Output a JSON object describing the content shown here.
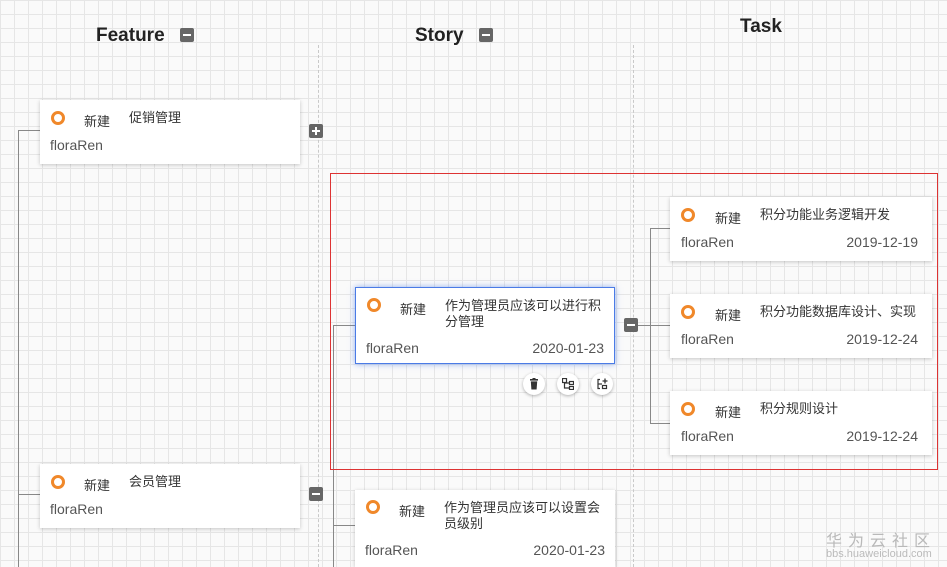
{
  "columns": {
    "feature": "Feature",
    "story": "Story",
    "task": "Task"
  },
  "features": [
    {
      "status": "新建",
      "title": "促销管理",
      "owner": "floraRen"
    },
    {
      "status": "新建",
      "title": "会员管理",
      "owner": "floraRen"
    }
  ],
  "stories": [
    {
      "status": "新建",
      "title": "作为管理员应该可以进行积分管理",
      "owner": "floraRen",
      "date": "2020-01-23"
    },
    {
      "status": "新建",
      "title": "作为管理员应该可以设置会员级别",
      "owner": "floraRen",
      "date": "2020-01-23"
    }
  ],
  "tasks": [
    {
      "status": "新建",
      "title": "积分功能业务逻辑开发",
      "owner": "floraRen",
      "date": "2019-12-19"
    },
    {
      "status": "新建",
      "title": "积分功能数据库设计、实现",
      "owner": "floraRen",
      "date": "2019-12-24"
    },
    {
      "status": "新建",
      "title": "积分规则设计",
      "owner": "floraRen",
      "date": "2019-12-24"
    }
  ],
  "story_actions": [
    "delete-icon",
    "hierarchy-icon",
    "add-child-icon"
  ],
  "colors": {
    "status_ring": "#f0882a",
    "selection": "#4a7be6",
    "highlight_box": "#dd3333"
  },
  "watermark": {
    "name": "华为云社区",
    "url": "bbs.huaweicloud.com"
  }
}
